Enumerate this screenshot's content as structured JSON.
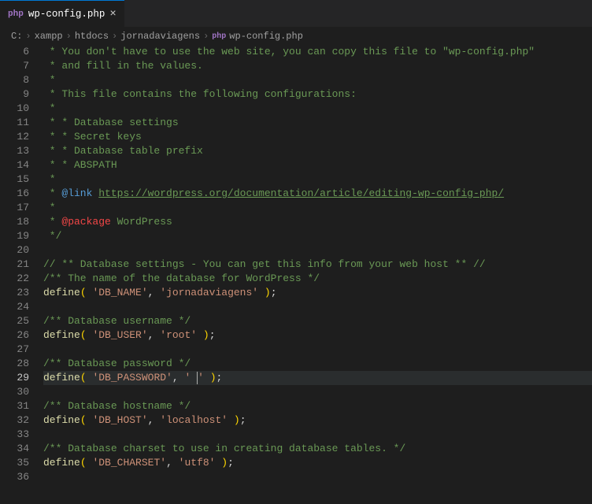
{
  "tab": {
    "filename": "wp-config.php",
    "icon": "php"
  },
  "breadcrumb": [
    "C:",
    "xampp",
    "htdocs",
    "jornadaviagens",
    "wp-config.php"
  ],
  "lines": [
    {
      "n": 6,
      "kind": "comment",
      "text": " * You don't have to use the web site, you can copy this file to \"wp-config.php\""
    },
    {
      "n": 7,
      "kind": "comment",
      "text": " * and fill in the values."
    },
    {
      "n": 8,
      "kind": "comment",
      "text": " *"
    },
    {
      "n": 9,
      "kind": "comment",
      "text": " * This file contains the following configurations:"
    },
    {
      "n": 10,
      "kind": "comment",
      "text": " *"
    },
    {
      "n": 11,
      "kind": "comment",
      "text": " * * Database settings"
    },
    {
      "n": 12,
      "kind": "comment",
      "text": " * * Secret keys"
    },
    {
      "n": 13,
      "kind": "comment",
      "text": " * * Database table prefix"
    },
    {
      "n": 14,
      "kind": "comment",
      "text": " * * ABSPATH"
    },
    {
      "n": 15,
      "kind": "comment",
      "text": " *"
    },
    {
      "n": 16,
      "kind": "link",
      "prefix": " * ",
      "annot": "@link",
      "url": "https://wordpress.org/documentation/article/editing-wp-config-php/"
    },
    {
      "n": 17,
      "kind": "comment",
      "text": " *"
    },
    {
      "n": 18,
      "kind": "package",
      "prefix": " * ",
      "annot": "@package",
      "pkg": "WordPress"
    },
    {
      "n": 19,
      "kind": "comment",
      "text": " */"
    },
    {
      "n": 20,
      "kind": "blank",
      "text": ""
    },
    {
      "n": 21,
      "kind": "comment",
      "text": "// ** Database settings - You can get this info from your web host ** //"
    },
    {
      "n": 22,
      "kind": "comment",
      "text": "/** The name of the database for WordPress */"
    },
    {
      "n": 23,
      "kind": "define",
      "key": "DB_NAME",
      "val": "jornadaviagens"
    },
    {
      "n": 24,
      "kind": "blank",
      "text": ""
    },
    {
      "n": 25,
      "kind": "comment",
      "text": "/** Database username */"
    },
    {
      "n": 26,
      "kind": "define",
      "key": "DB_USER",
      "val": "root"
    },
    {
      "n": 27,
      "kind": "blank",
      "text": ""
    },
    {
      "n": 28,
      "kind": "comment",
      "text": "/** Database password */"
    },
    {
      "n": 29,
      "kind": "define",
      "key": "DB_PASSWORD",
      "val": " ",
      "cursor": true,
      "current": true
    },
    {
      "n": 30,
      "kind": "blank",
      "text": ""
    },
    {
      "n": 31,
      "kind": "comment",
      "text": "/** Database hostname */"
    },
    {
      "n": 32,
      "kind": "define",
      "key": "DB_HOST",
      "val": "localhost"
    },
    {
      "n": 33,
      "kind": "blank",
      "text": ""
    },
    {
      "n": 34,
      "kind": "comment",
      "text": "/** Database charset to use in creating database tables. */"
    },
    {
      "n": 35,
      "kind": "define",
      "key": "DB_CHARSET",
      "val": "utf8"
    },
    {
      "n": 36,
      "kind": "blank",
      "text": ""
    }
  ]
}
